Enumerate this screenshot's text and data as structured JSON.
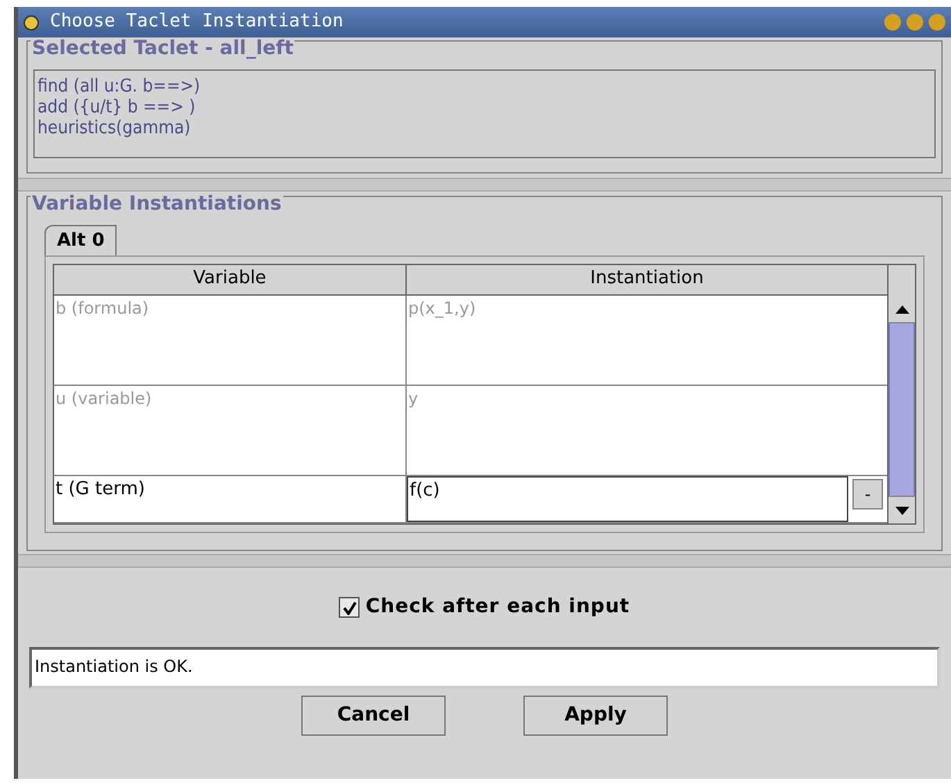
{
  "window": {
    "title": "Choose Taclet Instantiation"
  },
  "taclet_panel": {
    "legend": "Selected Taclet - all_left",
    "lines": [
      "find (all u:G. b==>)",
      "add ({u/t} b ==> )",
      "heuristics(gamma)"
    ]
  },
  "instantiation_panel": {
    "legend": "Variable Instantiations",
    "tabs": [
      {
        "label": "Alt 0",
        "selected": true
      }
    ],
    "table": {
      "columns": [
        "Variable",
        "Instantiation"
      ],
      "rows": [
        {
          "variable": "b (formula)",
          "instantiation": "p(x_1,y)",
          "editable": false
        },
        {
          "variable": "u (variable)",
          "instantiation": "y",
          "editable": false
        },
        {
          "variable": "t (G term)",
          "instantiation": "f(c)",
          "editable": true,
          "button": "-"
        }
      ]
    }
  },
  "check_after_input": {
    "label": "Check after each input",
    "checked": true
  },
  "status": {
    "text": "Instantiation is OK."
  },
  "buttons": [
    "Cancel",
    "Apply"
  ]
}
